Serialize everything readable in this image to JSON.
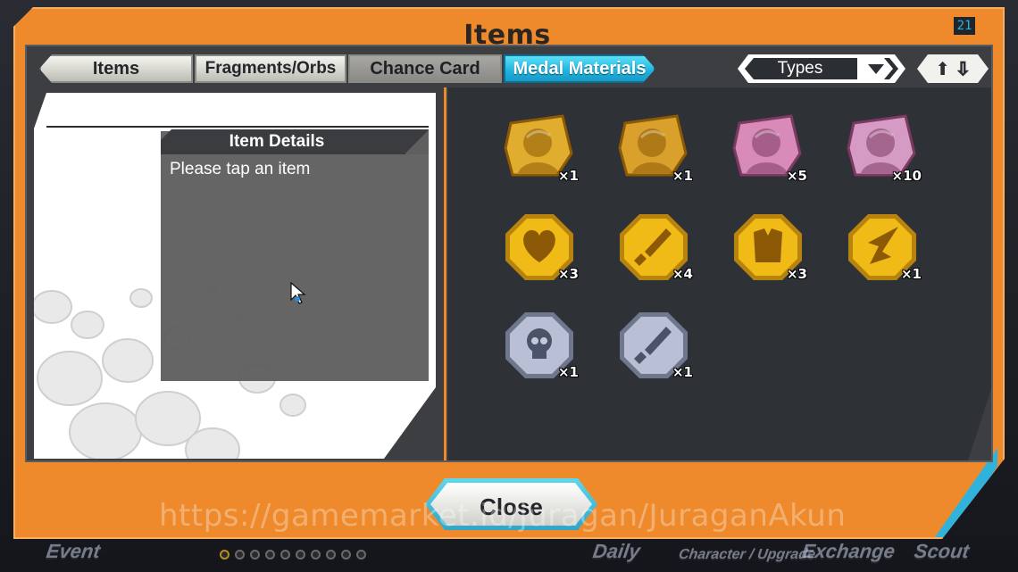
{
  "window": {
    "title": "Items",
    "counter": "21"
  },
  "tabs": [
    {
      "label": "Items",
      "active": false
    },
    {
      "label": "Fragments/Orbs",
      "active": false
    },
    {
      "label": "Chance Card",
      "active": false
    },
    {
      "label": "Medal Materials",
      "active": true
    }
  ],
  "filters": {
    "types_label": "Types",
    "sort_icon": "sort-up-down-icon"
  },
  "item_details": {
    "heading": "Item Details",
    "message": "Please tap an item"
  },
  "medals": [
    {
      "icon": "zoro-gold-medal-icon",
      "qty": "×1",
      "tier": "gold-portrait",
      "color": "#e0ad2f"
    },
    {
      "icon": "luffy-gold-medal-icon",
      "qty": "×1",
      "tier": "gold-portrait",
      "color": "#d9a12b"
    },
    {
      "icon": "pink-character-medal-icon",
      "qty": "×5",
      "tier": "pink-portrait",
      "color": "#d88bb9"
    },
    {
      "icon": "pink-pirate-medal-icon",
      "qty": "×10",
      "tier": "pink-portrait",
      "color": "#d59bc4"
    },
    {
      "icon": "heart-gold-medal-icon",
      "qty": "×3",
      "tier": "gold-octagon",
      "color": "#f0bb16"
    },
    {
      "icon": "sword-gold-medal-icon",
      "qty": "×4",
      "tier": "gold-octagon",
      "color": "#f0bb16"
    },
    {
      "icon": "armor-gold-medal-icon",
      "qty": "×3",
      "tier": "gold-octagon",
      "color": "#f0bb16"
    },
    {
      "icon": "spike-gold-medal-icon",
      "qty": "×1",
      "tier": "gold-octagon",
      "color": "#f0bb16"
    },
    {
      "icon": "skull-silver-medal-icon",
      "qty": "×1",
      "tier": "silver-octagon",
      "color": "#b9c0d6"
    },
    {
      "icon": "sword-silver-medal-icon",
      "qty": "×1",
      "tier": "silver-octagon",
      "color": "#b9c0d6"
    }
  ],
  "close_label": "Close",
  "watermark": "https://gamemarket.id/juragan/JuraganAkun",
  "background_nav": [
    "Event",
    "Daily",
    "Character / Upgrade",
    "Exchange",
    "Scout"
  ]
}
